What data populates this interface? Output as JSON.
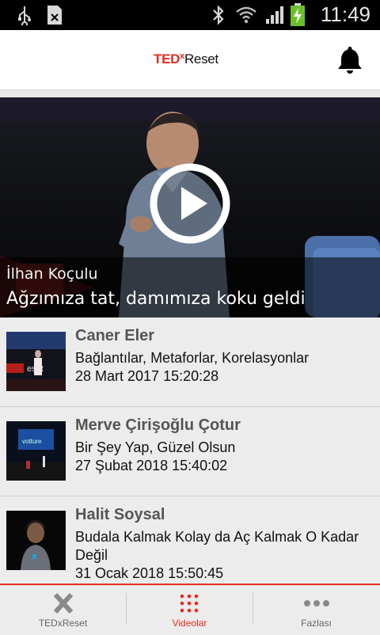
{
  "status_bar": {
    "time": "11:49",
    "icons": [
      "usb-icon",
      "sim-icon",
      "bluetooth-icon",
      "wifi-icon",
      "signal-icon",
      "battery-charging-icon"
    ]
  },
  "header": {
    "logo_ted": "TED",
    "logo_x": "x",
    "logo_reset": "Reset",
    "notification_icon": "bell-icon"
  },
  "featured": {
    "speaker": "İlhan Koçulu",
    "title": "Ağzımıza tat, damımıza koku geldi",
    "play_icon": "play-icon"
  },
  "videos": [
    {
      "speaker": "Caner Eler",
      "title": "Bağlantılar, Metaforlar, Korelasyonlar",
      "date": "28 Mart 2017 15:20:28"
    },
    {
      "speaker": "Merve Çirişoğlu Çotur",
      "title": "Bir Şey Yap, Güzel Olsun",
      "date": "27 Şubat 2018 15:40:02"
    },
    {
      "speaker": "Halit Soysal",
      "title": "Budala Kalmak Kolay da Aç Kalmak O Kadar Değil",
      "date": "31 Ocak 2018 15:50:45"
    }
  ],
  "nav": {
    "tabs": [
      {
        "label": "TEDxReset",
        "icon": "x-icon"
      },
      {
        "label": "Videolar",
        "icon": "grid-dots-icon"
      },
      {
        "label": "Fazlası",
        "icon": "more-dots-icon"
      }
    ],
    "active_index": 1
  },
  "colors": {
    "accent": "#e62b1e",
    "status_bar": "#000000",
    "list_bg": "#ececec"
  }
}
